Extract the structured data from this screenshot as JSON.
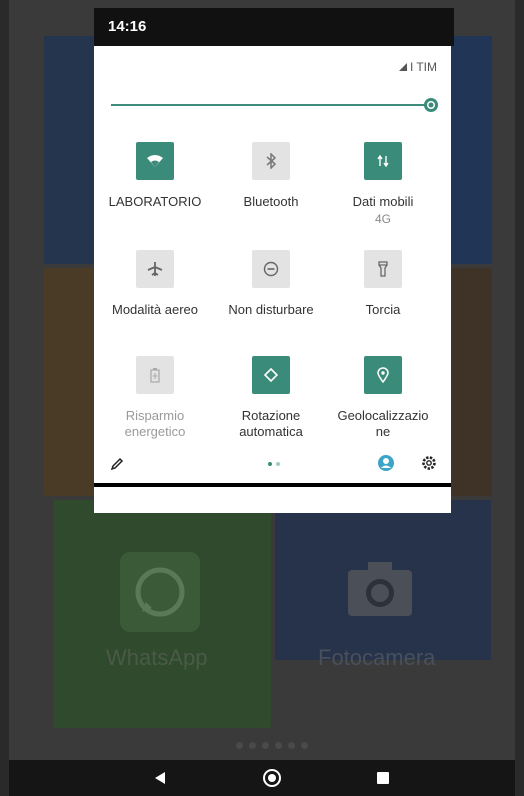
{
  "status_bar": {
    "time": "14:16"
  },
  "quick_settings": {
    "carrier": "TIM",
    "brightness_level": 0.97,
    "accent_color": "#3b8b7a",
    "tiles": [
      {
        "label": "LABORATORIO",
        "sub": "",
        "icon": "wifi-icon",
        "active": true
      },
      {
        "label": "Bluetooth",
        "sub": "",
        "icon": "bluetooth-icon",
        "active": false
      },
      {
        "label": "Dati mobili",
        "sub": "4G",
        "icon": "mobile-data-icon",
        "active": true
      },
      {
        "label": "Modalità aereo",
        "sub": "",
        "icon": "airplane-icon",
        "active": false
      },
      {
        "label": "Non disturbare",
        "sub": "",
        "icon": "do-not-disturb-icon",
        "active": false
      },
      {
        "label": "Torcia",
        "sub": "",
        "icon": "flashlight-icon",
        "active": false
      },
      {
        "label": "Risparmio energetico",
        "sub": "",
        "icon": "battery-saver-icon",
        "active": false
      },
      {
        "label": "Rotazione automatica",
        "sub": "",
        "icon": "auto-rotate-icon",
        "active": true
      },
      {
        "label": "Geolocalizzazione",
        "sub": "",
        "icon": "location-icon",
        "active": true
      }
    ]
  },
  "home_background": {
    "apps": [
      {
        "label": "WhatsApp",
        "icon": "whatsapp-icon"
      },
      {
        "label": "Fotocamera",
        "icon": "camera-icon"
      }
    ]
  },
  "nav_bar": {
    "buttons": [
      "back-icon",
      "home-icon",
      "recents-icon"
    ]
  }
}
